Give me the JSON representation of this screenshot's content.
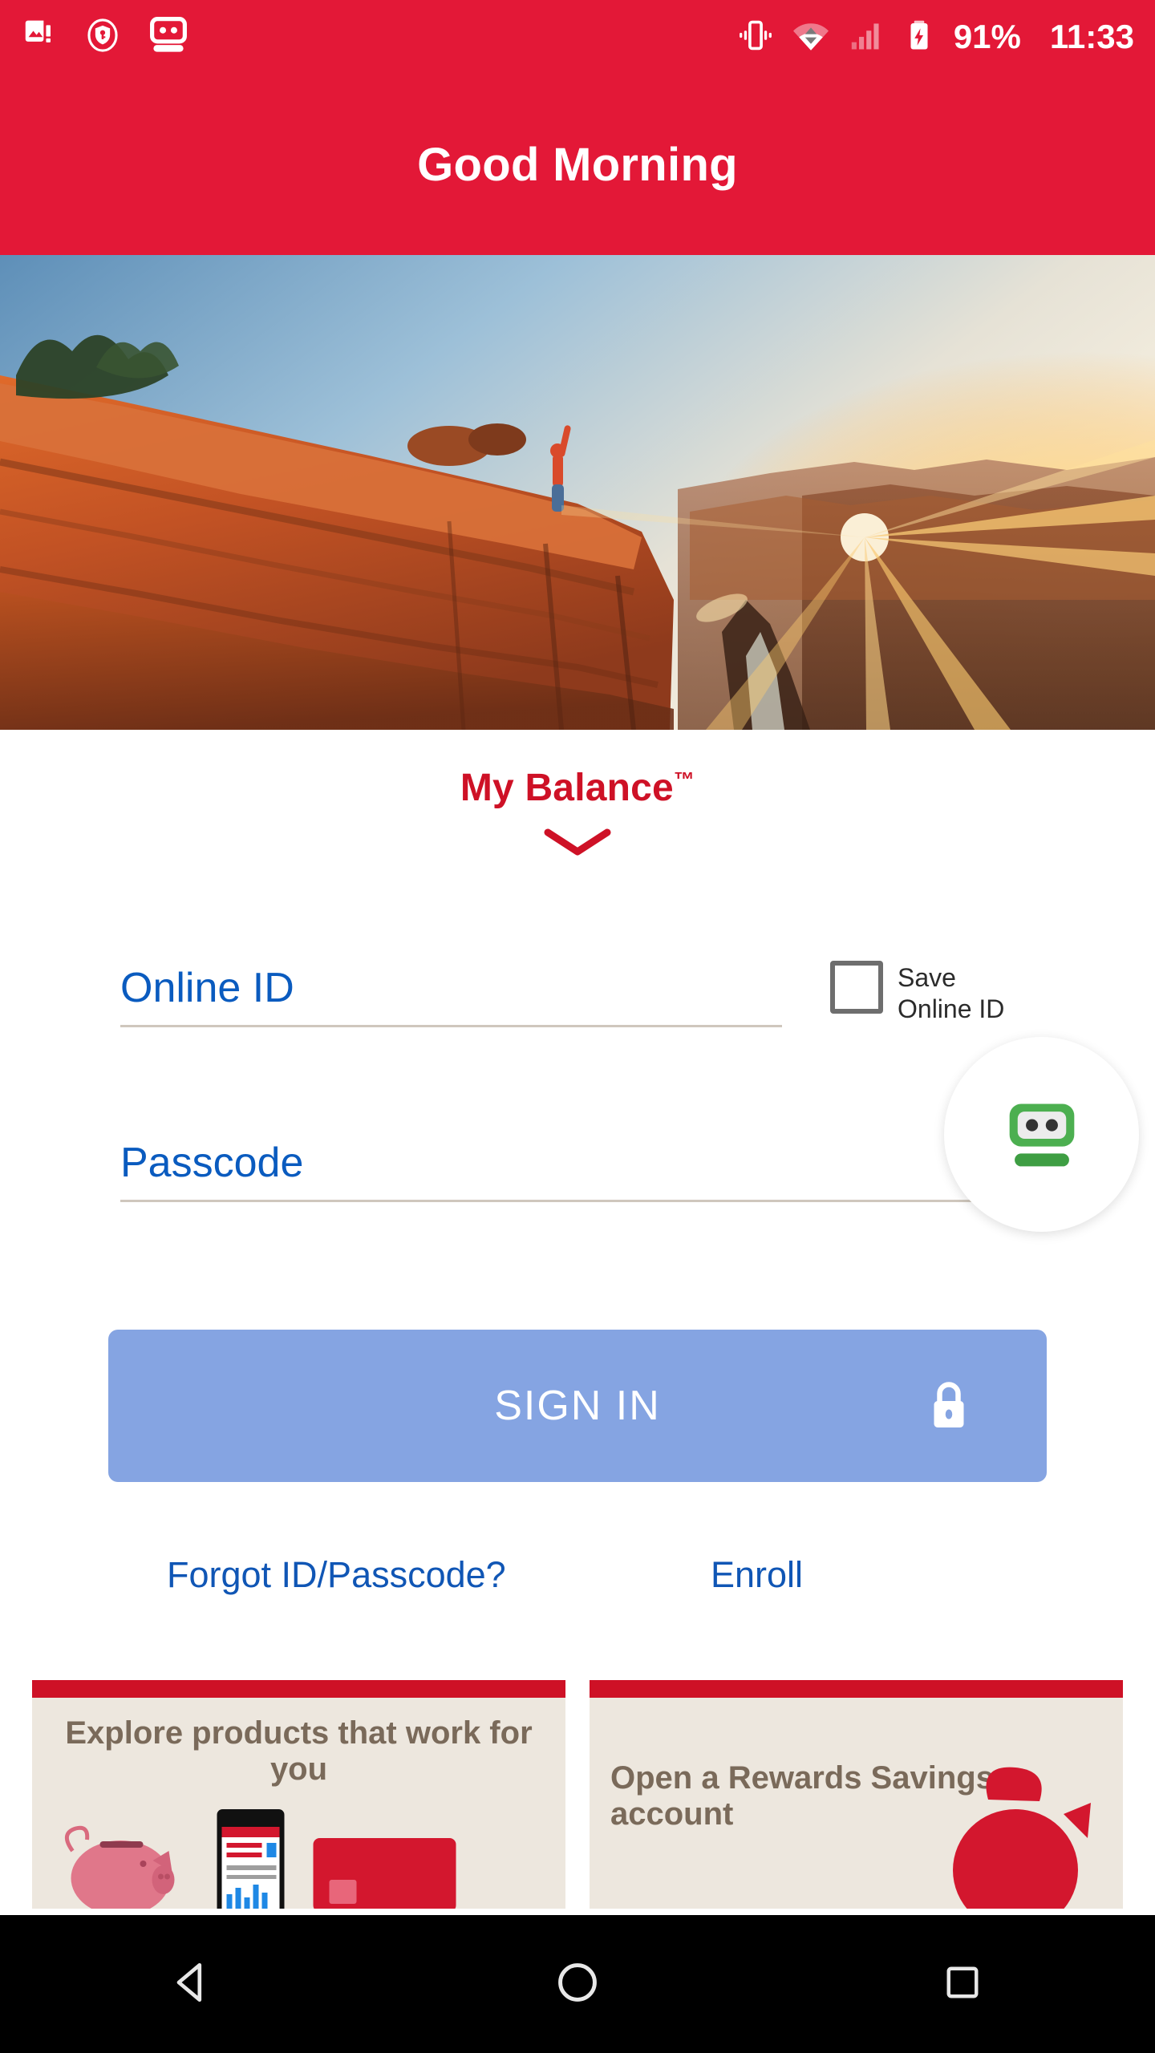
{
  "status_bar": {
    "background": "#E31837",
    "left_icons": [
      {
        "name": "image-alert-icon",
        "label": "Screenshot capture alert"
      },
      {
        "name": "vpn-shield-key-icon",
        "label": "VPN active"
      },
      {
        "name": "roboform-robot-icon",
        "label": "RoboForm"
      }
    ],
    "right_icons": [
      {
        "name": "vibrate-icon",
        "label": "Vibrate mode"
      },
      {
        "name": "wifi-icon",
        "label": "Wi-Fi connected"
      },
      {
        "name": "cellular-signal-icon",
        "label": "Cellular signal"
      },
      {
        "name": "battery-charging-icon",
        "label": "Battery charging"
      }
    ],
    "battery_percent": "91%",
    "time": "11:33"
  },
  "app_bar": {
    "title": "Good Morning",
    "background": "#E31837",
    "text_color": "#FFFFFF"
  },
  "hero": {
    "alt": "Grand Canyon cliff at sunrise with a person standing on the rim"
  },
  "balance": {
    "label": "My Balance",
    "trademark": "™",
    "color": "#CE1126",
    "chevron": "chevron-down-icon"
  },
  "form": {
    "online_id": {
      "placeholder": "Online ID",
      "value": "",
      "text_color": "#0A5BBF",
      "underline_color": "#CFC7BD"
    },
    "passcode": {
      "placeholder": "Passcode",
      "value": "",
      "text_color": "#0A5BBF",
      "underline_color": "#CFC7BD"
    },
    "save_online_id": {
      "label": "Save\nOnline ID",
      "checked": false
    },
    "roboform_button": {
      "name": "roboform-autofill-button",
      "accent": "#4CAF50"
    }
  },
  "sign_in": {
    "label": "SIGN IN",
    "background": "#85A4E2",
    "text_color": "#FFFFFF",
    "icon": "lock-icon",
    "enabled": false
  },
  "links": [
    {
      "id": "forgot",
      "label": "Forgot ID/Passcode?",
      "color": "#1056B5"
    },
    {
      "id": "enroll",
      "label": "Enroll",
      "color": "#1056B5"
    }
  ],
  "promos": [
    {
      "title": "Explore products that work for you",
      "bar_color": "#CE1126",
      "background": "#EDE7DE",
      "text_color": "#7A6A5A",
      "art": "piggy-bank-phone-card-illustration"
    },
    {
      "title": "Open a Rewards Savings account",
      "bar_color": "#CE1126",
      "background": "#EDE7DE",
      "text_color": "#7A6A5A",
      "art": "red-piggy-bank-illustration"
    }
  ],
  "nav_bar": {
    "background": "#000000",
    "buttons": [
      {
        "name": "back-button",
        "icon": "triangle-left-icon"
      },
      {
        "name": "home-button",
        "icon": "circle-icon"
      },
      {
        "name": "recents-button",
        "icon": "square-icon"
      }
    ]
  }
}
